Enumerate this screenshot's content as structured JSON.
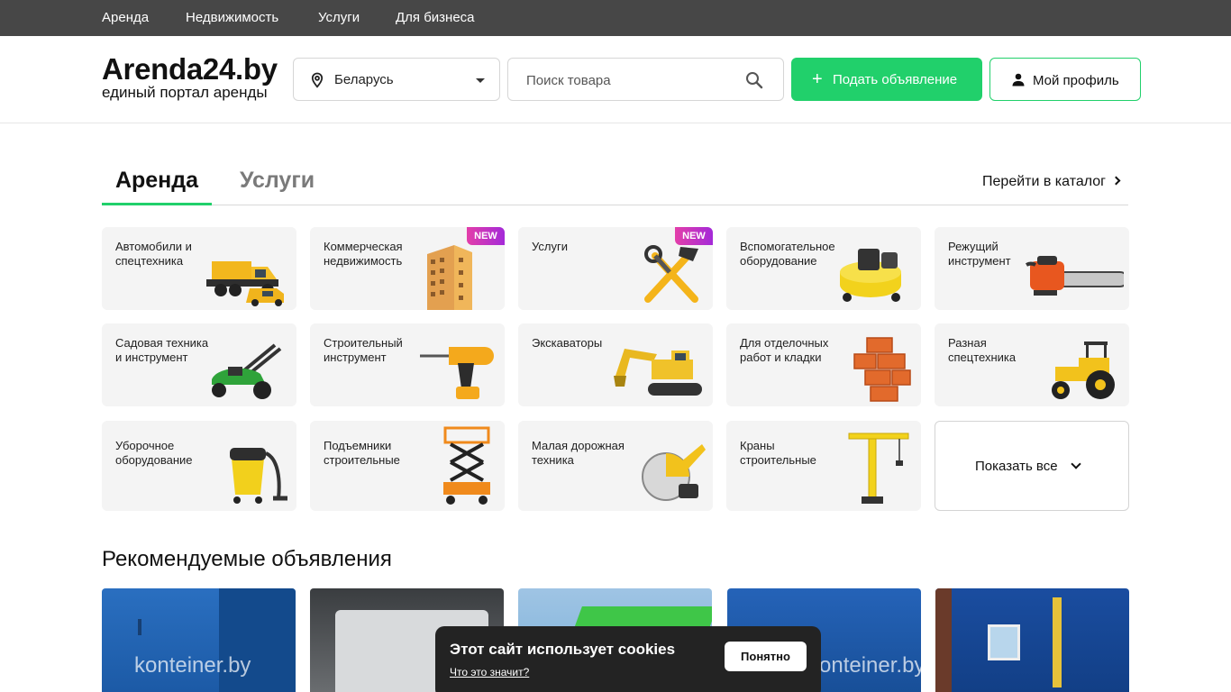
{
  "topnav": [
    "Аренда",
    "Недвижимость",
    "Услуги",
    "Для бизнеса"
  ],
  "header": {
    "logo": "Arenda24.by",
    "tagline": "единый портал аренды",
    "region": "Беларусь",
    "search_placeholder": "Поиск товара",
    "post_button": "Подать объявление",
    "profile_button": "Мой профиль",
    "accent": "#21d06b"
  },
  "tabs": {
    "active": "Аренда",
    "inactive": "Услуги",
    "catalog_link": "Перейти в каталог"
  },
  "categories": [
    {
      "title": "Автомобили и спецтехника",
      "icon": "dump-truck-icon"
    },
    {
      "title": "Коммерческая недвижимость",
      "icon": "building-icon",
      "badge": "NEW"
    },
    {
      "title": "Услуги",
      "icon": "hammer-wrench-icon",
      "badge": "NEW"
    },
    {
      "title": "Вспомогательное оборудование",
      "icon": "compressor-icon"
    },
    {
      "title": "Режущий инструмент",
      "icon": "chainsaw-icon"
    },
    {
      "title": "Садовая техника и инструмент",
      "icon": "lawnmower-icon"
    },
    {
      "title": "Строительный инструмент",
      "icon": "drill-icon"
    },
    {
      "title": "Экскаваторы",
      "icon": "excavator-icon"
    },
    {
      "title": "Для отделочных работ и кладки",
      "icon": "bricks-icon"
    },
    {
      "title": "Разная спецтехника",
      "icon": "tractor-icon"
    },
    {
      "title": "Уборочное оборудование",
      "icon": "vacuum-icon"
    },
    {
      "title": "Подъемники строительные",
      "icon": "scissor-lift-icon"
    },
    {
      "title": "Малая дорожная техника",
      "icon": "road-saw-icon"
    },
    {
      "title": "Краны строительные",
      "icon": "crane-icon"
    }
  ],
  "show_all": "Показать все",
  "recommended_title": "Рекомендуемые объявления",
  "listing_watermark": "konteiner.by",
  "cookie": {
    "title": "Этот сайт использует cookies",
    "link": "Что это значит?",
    "button": "Понятно"
  }
}
